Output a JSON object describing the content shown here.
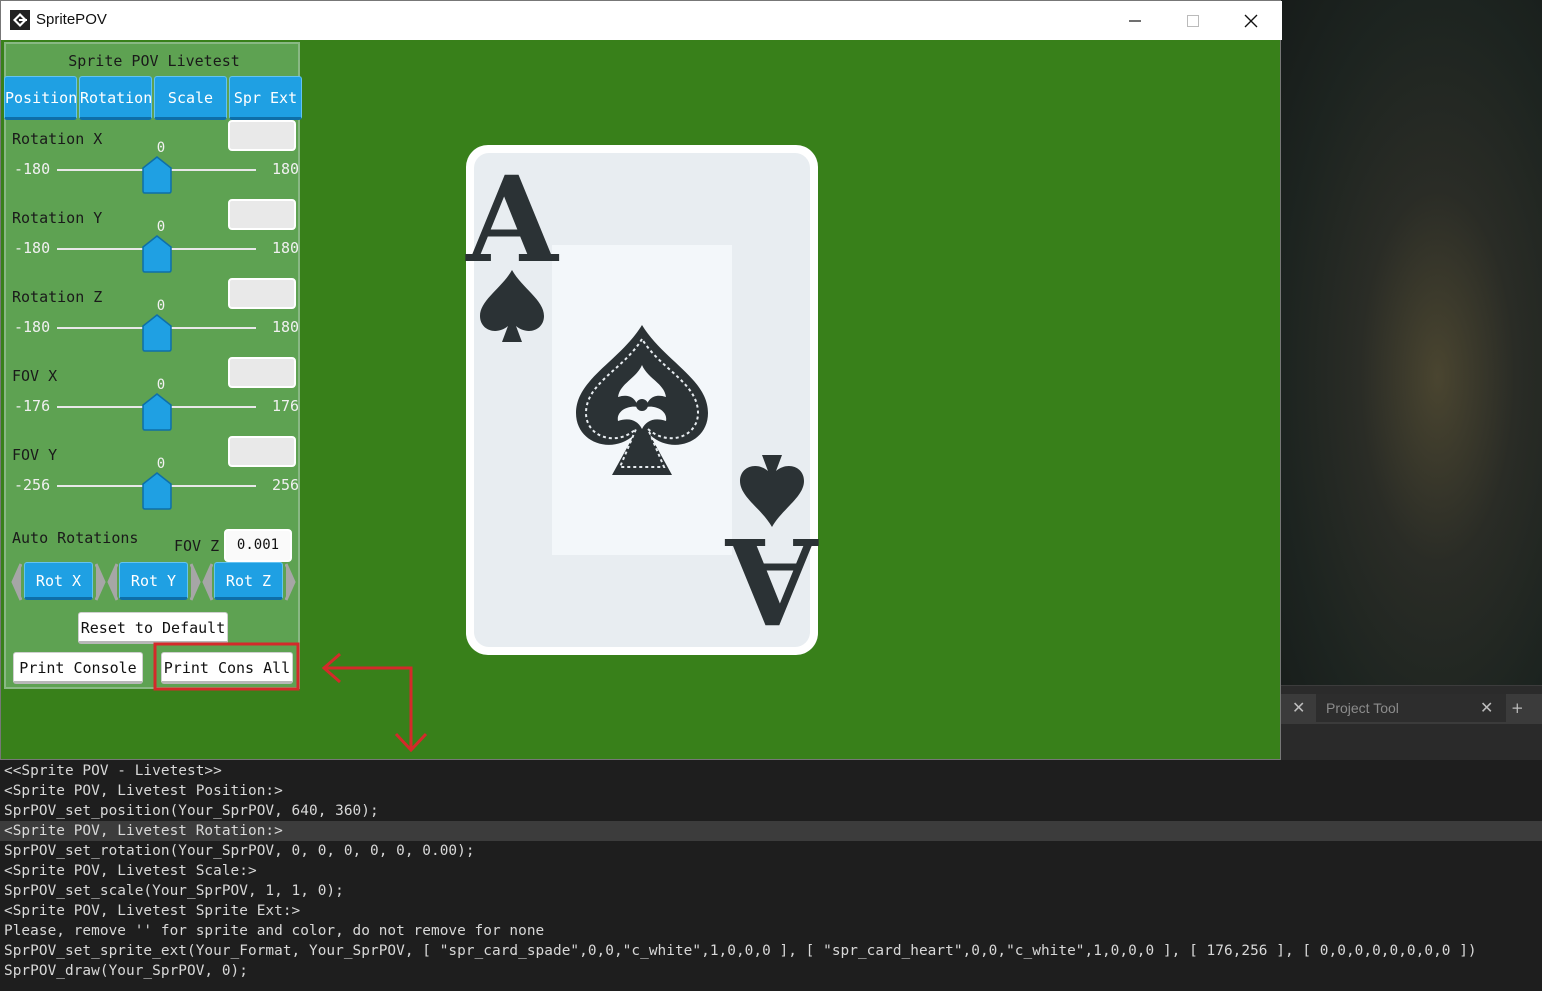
{
  "window": {
    "title": "SpritePOV"
  },
  "panel": {
    "title": "Sprite POV Livetest",
    "tabs": [
      {
        "label": "Position"
      },
      {
        "label": "Rotation"
      },
      {
        "label": "Scale"
      },
      {
        "label": "Spr Ext"
      }
    ],
    "sliders": [
      {
        "label": "Rotation X",
        "min": "-180",
        "max": "180",
        "value": "0"
      },
      {
        "label": "Rotation Y",
        "min": "-180",
        "max": "180",
        "value": "0"
      },
      {
        "label": "Rotation Z",
        "min": "-180",
        "max": "180",
        "value": "0"
      },
      {
        "label": "FOV X",
        "min": "-176",
        "max": "176",
        "value": "0"
      },
      {
        "label": "FOV Y",
        "min": "-256",
        "max": "256",
        "value": "0"
      }
    ],
    "auto_rotations_label": "Auto Rotations",
    "fov_z_label": "FOV Z",
    "fov_z_value": "0.001",
    "rot_buttons": [
      {
        "label": "Rot X"
      },
      {
        "label": "Rot Y"
      },
      {
        "label": "Rot Z"
      }
    ],
    "reset_label": "Reset to Default",
    "print_console_label": "Print Console",
    "print_cons_all_label": "Print Cons All"
  },
  "card": {
    "rank": "A",
    "suit": "spade"
  },
  "ide": {
    "tab_label": "Project Tool",
    "plus": "+"
  },
  "console": {
    "highlight_index": 3,
    "lines": [
      "<<Sprite POV - Livetest>>",
      "<Sprite POV, Livetest Position:>",
      "SprPOV_set_position(Your_SprPOV, 640, 360);",
      "<Sprite POV, Livetest Rotation:>",
      "SprPOV_set_rotation(Your_SprPOV, 0, 0, 0, 0, 0, 0.00);",
      "<Sprite POV, Livetest Scale:>",
      "SprPOV_set_scale(Your_SprPOV, 1, 1, 0);",
      "<Sprite POV, Livetest Sprite Ext:>",
      "Please, remove '' for sprite and color, do not remove for none",
      "SprPOV_set_sprite_ext(Your_Format, Your_SprPOV, [ \"spr_card_spade\",0,0,\"c_white\",1,0,0,0 ], [ \"spr_card_heart\",0,0,\"c_white\",1,0,0,0 ], [ 176,256 ], [ 0,0,0,0,0,0,0,0 ])",
      "SprPOV_draw(Your_SprPOV, 0);"
    ]
  },
  "colors": {
    "game_bg": "#38801a",
    "panel_bg": "#5ea252",
    "button_blue": "#1fa0e3",
    "annotation_red": "#d42a2a"
  }
}
